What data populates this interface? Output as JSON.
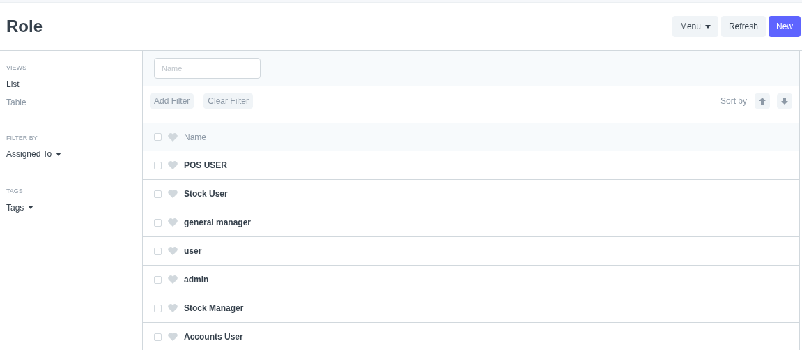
{
  "page": {
    "title": "Role"
  },
  "actions": [
    {
      "label": "Menu",
      "kind": "dropdown"
    },
    {
      "label": "Refresh",
      "kind": "plain"
    },
    {
      "label": "New",
      "kind": "primary"
    }
  ],
  "sidebar": {
    "sections": [
      {
        "heading": "VIEWS",
        "kind": "views",
        "items": [
          {
            "label": "List",
            "selected": true
          },
          {
            "label": "Table",
            "selected": false
          }
        ]
      },
      {
        "heading": "FILTER BY",
        "kind": "dropdown",
        "items": [
          {
            "label": "Assigned To"
          }
        ]
      },
      {
        "heading": "TAGS",
        "kind": "dropdown",
        "items": [
          {
            "label": "Tags"
          }
        ]
      }
    ]
  },
  "filter_field": {
    "placeholder": "Name"
  },
  "filter_buttons": [
    "Add Filter",
    "Clear Filter"
  ],
  "sort": {
    "label": "Sort by"
  },
  "list": {
    "header": "Name",
    "all_checked": false,
    "rows": [
      {
        "name": "POS USER",
        "checked": false
      },
      {
        "name": "Stock User",
        "checked": false
      },
      {
        "name": "general manager",
        "checked": false
      },
      {
        "name": "user",
        "checked": false
      },
      {
        "name": "admin",
        "checked": false
      },
      {
        "name": "Stock Manager",
        "checked": false
      },
      {
        "name": "Accounts User",
        "checked": false
      }
    ]
  }
}
